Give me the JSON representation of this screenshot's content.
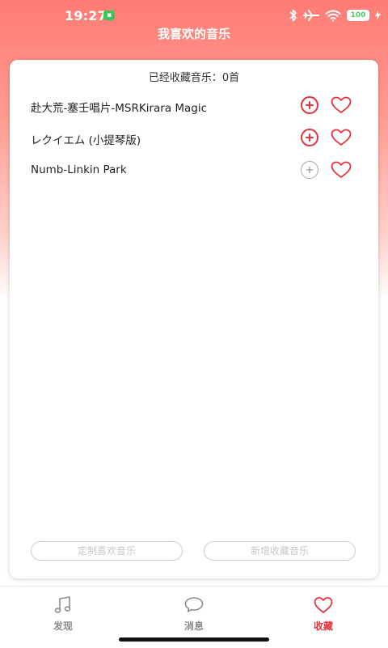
{
  "status_bar": {
    "time": "19:27",
    "battery": "100"
  },
  "header": {
    "title": "我喜欢的音乐"
  },
  "favorites": {
    "count_text": "已经收藏音乐：0首",
    "songs": [
      {
        "title": "赴大荒-塞壬唱片-MSRKirara Magic",
        "add_enabled": true
      },
      {
        "title": "レクイエム (小提琴版)",
        "add_enabled": true
      },
      {
        "title": "Numb-Linkin Park",
        "add_enabled": false
      }
    ],
    "custom_button": "定制喜欢音乐",
    "add_button": "新增收藏音乐"
  },
  "tabs": [
    {
      "label": "发现",
      "icon": "music-note-icon",
      "active": false
    },
    {
      "label": "消息",
      "icon": "chat-bubble-icon",
      "active": false
    },
    {
      "label": "收藏",
      "icon": "heart-icon",
      "active": true
    }
  ],
  "colors": {
    "accent": "#e3333b",
    "header_gradient_top": "#ff7c74",
    "disabled": "#a8a8a8",
    "tab_inactive": "#8c8c8c"
  }
}
